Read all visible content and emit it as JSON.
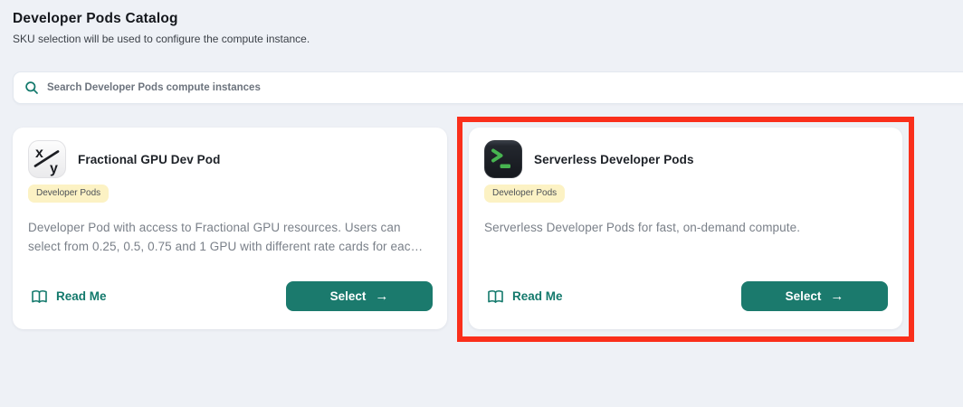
{
  "header": {
    "title": "Developer Pods Catalog",
    "subtitle": "SKU selection will be used to configure the compute instance."
  },
  "search": {
    "placeholder": "Search Developer Pods compute instances",
    "icon": "search-icon"
  },
  "icons": {
    "arrow_right": "→"
  },
  "cards": [
    {
      "title": "Fractional GPU Dev Pod",
      "icon": "fraction-xy-icon",
      "badge": "Developer Pods",
      "description": "Developer Pod with access to Fractional GPU resources. Users can select from 0.25, 0.5, 0.75 and 1 GPU with different rate cards for eac…",
      "readme_label": "Read Me",
      "select_label": "Select",
      "highlighted": false
    },
    {
      "title": "Serverless Developer Pods",
      "icon": "terminal-icon",
      "badge": "Developer Pods",
      "description": "Serverless Developer Pods for fast, on-demand compute.",
      "readme_label": "Read Me",
      "select_label": "Select",
      "highlighted": true
    }
  ],
  "colors": {
    "accent_teal": "#1b7a6d",
    "readme_teal": "#13796c",
    "badge_bg": "#fcf2c4",
    "highlight_red": "#fa2f1b",
    "page_bg": "#eef1f6",
    "card_bg": "#ffffff"
  }
}
